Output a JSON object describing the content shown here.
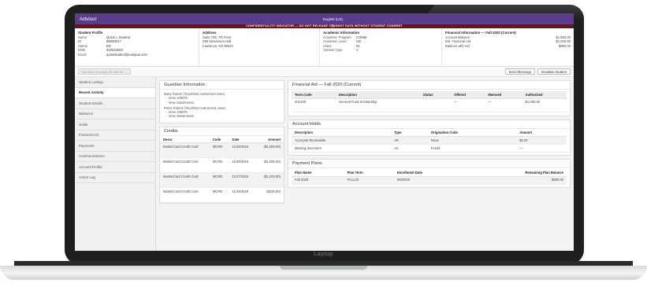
{
  "device": {
    "brand": "Laptop"
  },
  "app": {
    "title": "Advisor",
    "language": "English (US)",
    "confidentiality": "CONFIDENTIALITY INDICATOR — DO NOT RELEASE STUDENT DATA WITHOUT STUDENT CONSENT",
    "accent": "#5b3b8c",
    "alert_color": "#6b1414"
  },
  "profile": {
    "heading": "Student Profile",
    "fields": [
      {
        "label": "Name",
        "value": "Quinn L Student"
      },
      {
        "label": "ID",
        "value": "86000017"
      },
      {
        "label": "Status",
        "value": "ER"
      },
      {
        "label": "DOB",
        "value": "04/02/2002"
      },
      {
        "label": "Email",
        "value": "quinnstudent@campus.com"
      }
    ]
  },
  "address": {
    "heading": "Address",
    "lines": [
      "Suite 735, 7th Floor",
      "258 Stevenson Hall",
      "Lawrence, KS 66044"
    ]
  },
  "academic": {
    "heading": "Academic Information",
    "fields": [
      {
        "label": "Academic Program",
        "value": "COMM"
      },
      {
        "label": "Academic Level",
        "value": "UG"
      },
      {
        "label": "Class",
        "value": "01"
      },
      {
        "label": "Student Type",
        "value": "A"
      }
    ]
  },
  "financial": {
    "heading": "Financial Information — Fall 2020 (Current)",
    "fields": [
      {
        "label": "Account Balance",
        "value": "$1,980.00"
      },
      {
        "label": "Est. Financial Aid",
        "value": "$1,000.00"
      },
      {
        "label": "Balance with Aid",
        "value": "$980.00"
      }
    ]
  },
  "toolbar": {
    "term": "Fall 2020 (Current)",
    "term_amount": "$1,980.00",
    "send_message": "Send Message",
    "emulate": "Emulate Student"
  },
  "sidebar": {
    "items": [
      {
        "label": "Student Lookup"
      },
      {
        "label": "Recent Activity"
      },
      {
        "label": "Student Details"
      },
      {
        "label": "Balances"
      },
      {
        "label": "Holds"
      },
      {
        "label": "Financial Aid"
      },
      {
        "label": "Payments"
      },
      {
        "label": "Communications"
      },
      {
        "label": "Account Profile"
      },
      {
        "label": "Action Log"
      }
    ]
  },
  "guardian": {
    "title": "Guardian Information",
    "people": [
      {
        "name": "Mary Parent (TouchNet Authorized User)",
        "links": [
          "- View 1098Ts",
          "- View Statements"
        ]
      },
      {
        "name": "Peter Parent (TouchNet Authorized User)",
        "links": [
          "- View 1098Ts",
          "- View Statements"
        ]
      }
    ]
  },
  "credits": {
    "title": "Credits",
    "columns": [
      "Descr.",
      "Code",
      "Date",
      "Amount"
    ],
    "rows": [
      {
        "descr": "MasterCard Credit Card",
        "code": "MCRD",
        "date": "11/29/2018",
        "amount": "($1,000.00)"
      },
      {
        "descr": "MasterCard Credit Card",
        "code": "MCRD",
        "date": "11/28/2018",
        "amount": "($1,000.00)"
      },
      {
        "descr": "MasterCard Credit Card",
        "code": "MCRD",
        "date": "11/27/2018",
        "amount": "($1,200.00)"
      },
      {
        "descr": "MasterCard Credit Card",
        "code": "MCRD",
        "date": "11/19/2018",
        "amount": "($220.00)"
      }
    ]
  },
  "financial_aid": {
    "title": "Financial Aid — Fall 2020 (Current)",
    "columns": [
      "Term Code",
      "Description",
      "Status",
      "Offered",
      "Memoed",
      "Authorized"
    ],
    "rows": [
      {
        "term": "201209",
        "description": "General Fund Scholarship",
        "status": "",
        "offered": "—",
        "memoed": "—",
        "authorized": "$1,000.00"
      }
    ]
  },
  "holds": {
    "title": "Account Holds",
    "columns": [
      "Description",
      "Type",
      "Origination Code",
      "Amount"
    ],
    "rows": [
      {
        "description": "Accounts Receivable",
        "type": "AR",
        "origination": "None",
        "amount": "$2.00"
      },
      {
        "description": "Missing document",
        "type": "AC",
        "origination": "Feivid",
        "amount": "—"
      }
    ]
  },
  "plans": {
    "title": "Payment Plans",
    "columns": [
      "Plan Name",
      "Plan Term",
      "Enrollment Date",
      "Remaining Plan Balance"
    ],
    "rows": [
      {
        "name": "Fall 2020",
        "term": "FALL20",
        "enrollment": "9/6/2020",
        "balance": "$980.00"
      }
    ]
  }
}
